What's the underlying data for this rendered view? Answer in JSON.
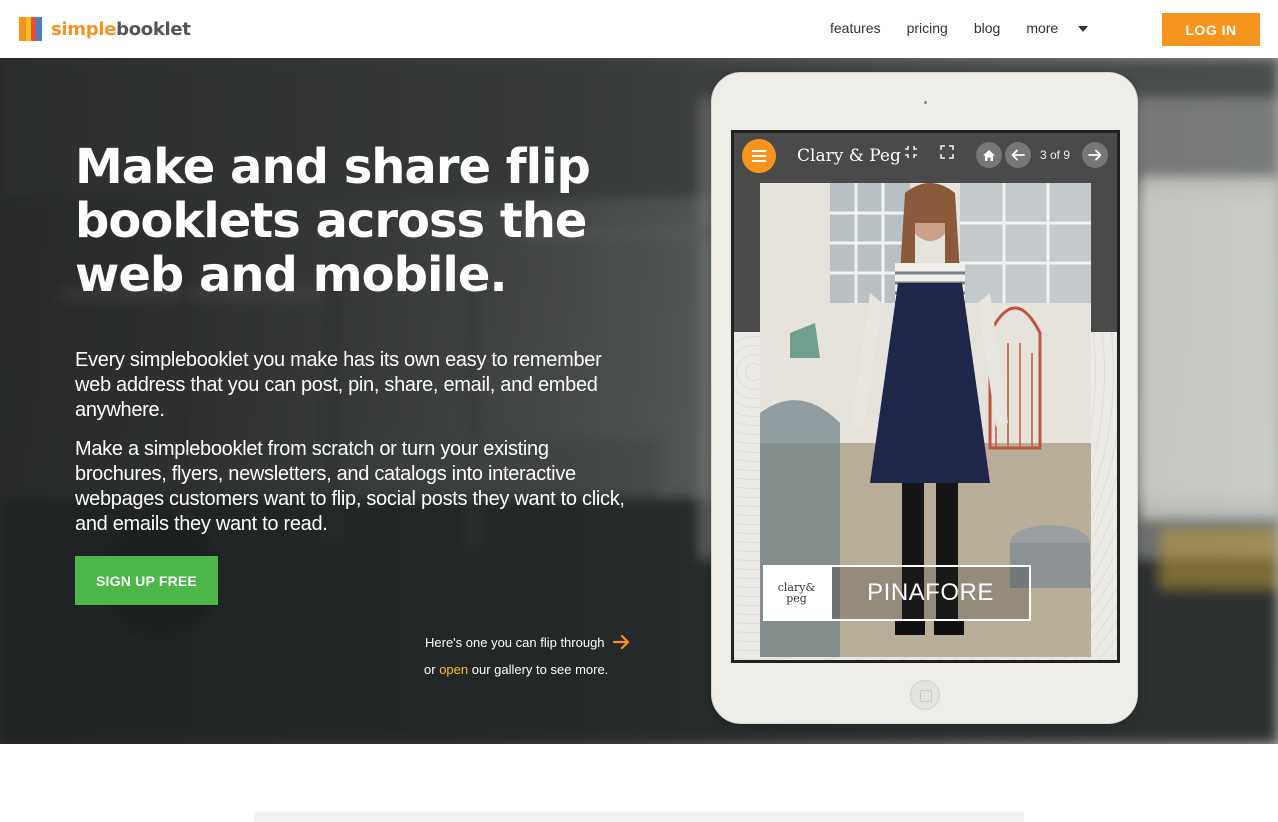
{
  "header": {
    "logo": {
      "part1": "simple",
      "part2": "booklet",
      "colors": [
        "#f6931f",
        "#f7c11d",
        "#e94f3a",
        "#4a7fc1"
      ]
    },
    "nav": [
      {
        "label": "features"
      },
      {
        "label": "pricing"
      },
      {
        "label": "blog"
      },
      {
        "label": "more"
      }
    ],
    "login_label": "LOG IN"
  },
  "hero": {
    "headline": "Make and share flip booklets across the web and mobile.",
    "paragraph1": "Every simplebooklet you make has its own easy to remember web address that you can post, pin, share, email, and embed anywhere.",
    "paragraph2": "Make a simplebooklet from scratch or turn your existing brochures, flyers, newsletters, and catalogs into interactive webpages customers want to flip, social posts they want to click, and emails they want to read.",
    "signup_label": "SIGN UP FREE",
    "flip_note": "Here's one you can flip through",
    "gallery_prefix": "or",
    "gallery_link": "open",
    "gallery_suffix": "our gallery to see more."
  },
  "viewer": {
    "title": "Clary & Peg",
    "page_indicator": "3 of 9",
    "caption_logo_line1": "clary&",
    "caption_logo_line2": "peg",
    "caption_title": "PINAFORE"
  },
  "colors": {
    "accent": "#f7941d",
    "signup": "#4cb649",
    "link": "#f7c11d"
  }
}
